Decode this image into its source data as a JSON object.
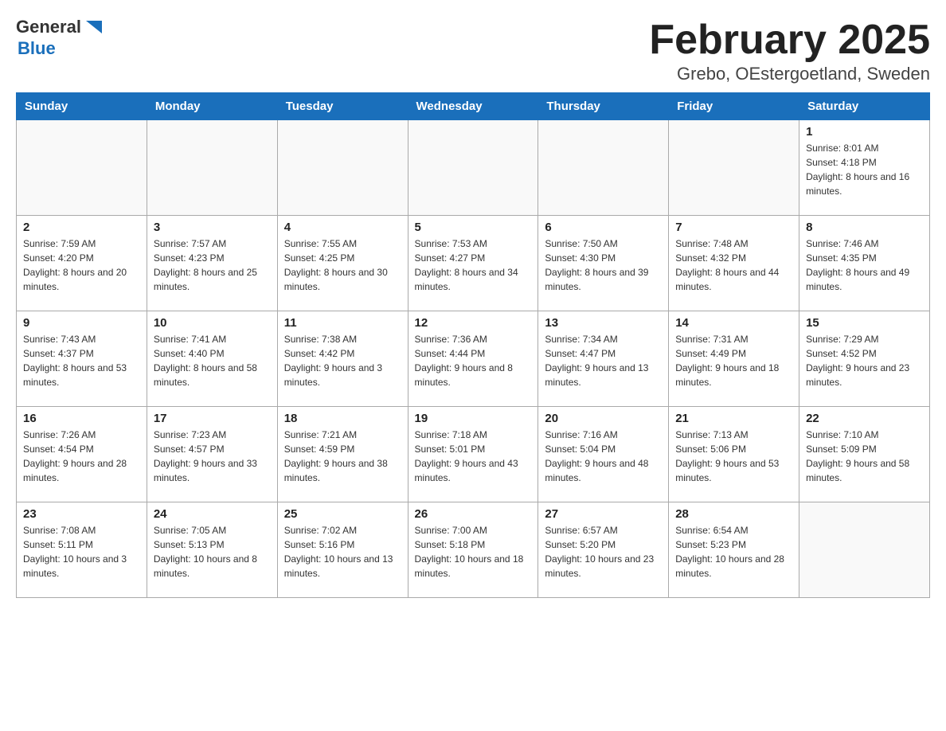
{
  "header": {
    "logo_general": "General",
    "logo_blue": "Blue",
    "month_title": "February 2025",
    "location": "Grebo, OEstergoetland, Sweden"
  },
  "weekdays": [
    "Sunday",
    "Monday",
    "Tuesday",
    "Wednesday",
    "Thursday",
    "Friday",
    "Saturday"
  ],
  "weeks": [
    [
      {
        "num": "",
        "info": ""
      },
      {
        "num": "",
        "info": ""
      },
      {
        "num": "",
        "info": ""
      },
      {
        "num": "",
        "info": ""
      },
      {
        "num": "",
        "info": ""
      },
      {
        "num": "",
        "info": ""
      },
      {
        "num": "1",
        "info": "Sunrise: 8:01 AM\nSunset: 4:18 PM\nDaylight: 8 hours and 16 minutes."
      }
    ],
    [
      {
        "num": "2",
        "info": "Sunrise: 7:59 AM\nSunset: 4:20 PM\nDaylight: 8 hours and 20 minutes."
      },
      {
        "num": "3",
        "info": "Sunrise: 7:57 AM\nSunset: 4:23 PM\nDaylight: 8 hours and 25 minutes."
      },
      {
        "num": "4",
        "info": "Sunrise: 7:55 AM\nSunset: 4:25 PM\nDaylight: 8 hours and 30 minutes."
      },
      {
        "num": "5",
        "info": "Sunrise: 7:53 AM\nSunset: 4:27 PM\nDaylight: 8 hours and 34 minutes."
      },
      {
        "num": "6",
        "info": "Sunrise: 7:50 AM\nSunset: 4:30 PM\nDaylight: 8 hours and 39 minutes."
      },
      {
        "num": "7",
        "info": "Sunrise: 7:48 AM\nSunset: 4:32 PM\nDaylight: 8 hours and 44 minutes."
      },
      {
        "num": "8",
        "info": "Sunrise: 7:46 AM\nSunset: 4:35 PM\nDaylight: 8 hours and 49 minutes."
      }
    ],
    [
      {
        "num": "9",
        "info": "Sunrise: 7:43 AM\nSunset: 4:37 PM\nDaylight: 8 hours and 53 minutes."
      },
      {
        "num": "10",
        "info": "Sunrise: 7:41 AM\nSunset: 4:40 PM\nDaylight: 8 hours and 58 minutes."
      },
      {
        "num": "11",
        "info": "Sunrise: 7:38 AM\nSunset: 4:42 PM\nDaylight: 9 hours and 3 minutes."
      },
      {
        "num": "12",
        "info": "Sunrise: 7:36 AM\nSunset: 4:44 PM\nDaylight: 9 hours and 8 minutes."
      },
      {
        "num": "13",
        "info": "Sunrise: 7:34 AM\nSunset: 4:47 PM\nDaylight: 9 hours and 13 minutes."
      },
      {
        "num": "14",
        "info": "Sunrise: 7:31 AM\nSunset: 4:49 PM\nDaylight: 9 hours and 18 minutes."
      },
      {
        "num": "15",
        "info": "Sunrise: 7:29 AM\nSunset: 4:52 PM\nDaylight: 9 hours and 23 minutes."
      }
    ],
    [
      {
        "num": "16",
        "info": "Sunrise: 7:26 AM\nSunset: 4:54 PM\nDaylight: 9 hours and 28 minutes."
      },
      {
        "num": "17",
        "info": "Sunrise: 7:23 AM\nSunset: 4:57 PM\nDaylight: 9 hours and 33 minutes."
      },
      {
        "num": "18",
        "info": "Sunrise: 7:21 AM\nSunset: 4:59 PM\nDaylight: 9 hours and 38 minutes."
      },
      {
        "num": "19",
        "info": "Sunrise: 7:18 AM\nSunset: 5:01 PM\nDaylight: 9 hours and 43 minutes."
      },
      {
        "num": "20",
        "info": "Sunrise: 7:16 AM\nSunset: 5:04 PM\nDaylight: 9 hours and 48 minutes."
      },
      {
        "num": "21",
        "info": "Sunrise: 7:13 AM\nSunset: 5:06 PM\nDaylight: 9 hours and 53 minutes."
      },
      {
        "num": "22",
        "info": "Sunrise: 7:10 AM\nSunset: 5:09 PM\nDaylight: 9 hours and 58 minutes."
      }
    ],
    [
      {
        "num": "23",
        "info": "Sunrise: 7:08 AM\nSunset: 5:11 PM\nDaylight: 10 hours and 3 minutes."
      },
      {
        "num": "24",
        "info": "Sunrise: 7:05 AM\nSunset: 5:13 PM\nDaylight: 10 hours and 8 minutes."
      },
      {
        "num": "25",
        "info": "Sunrise: 7:02 AM\nSunset: 5:16 PM\nDaylight: 10 hours and 13 minutes."
      },
      {
        "num": "26",
        "info": "Sunrise: 7:00 AM\nSunset: 5:18 PM\nDaylight: 10 hours and 18 minutes."
      },
      {
        "num": "27",
        "info": "Sunrise: 6:57 AM\nSunset: 5:20 PM\nDaylight: 10 hours and 23 minutes."
      },
      {
        "num": "28",
        "info": "Sunrise: 6:54 AM\nSunset: 5:23 PM\nDaylight: 10 hours and 28 minutes."
      },
      {
        "num": "",
        "info": ""
      }
    ]
  ]
}
